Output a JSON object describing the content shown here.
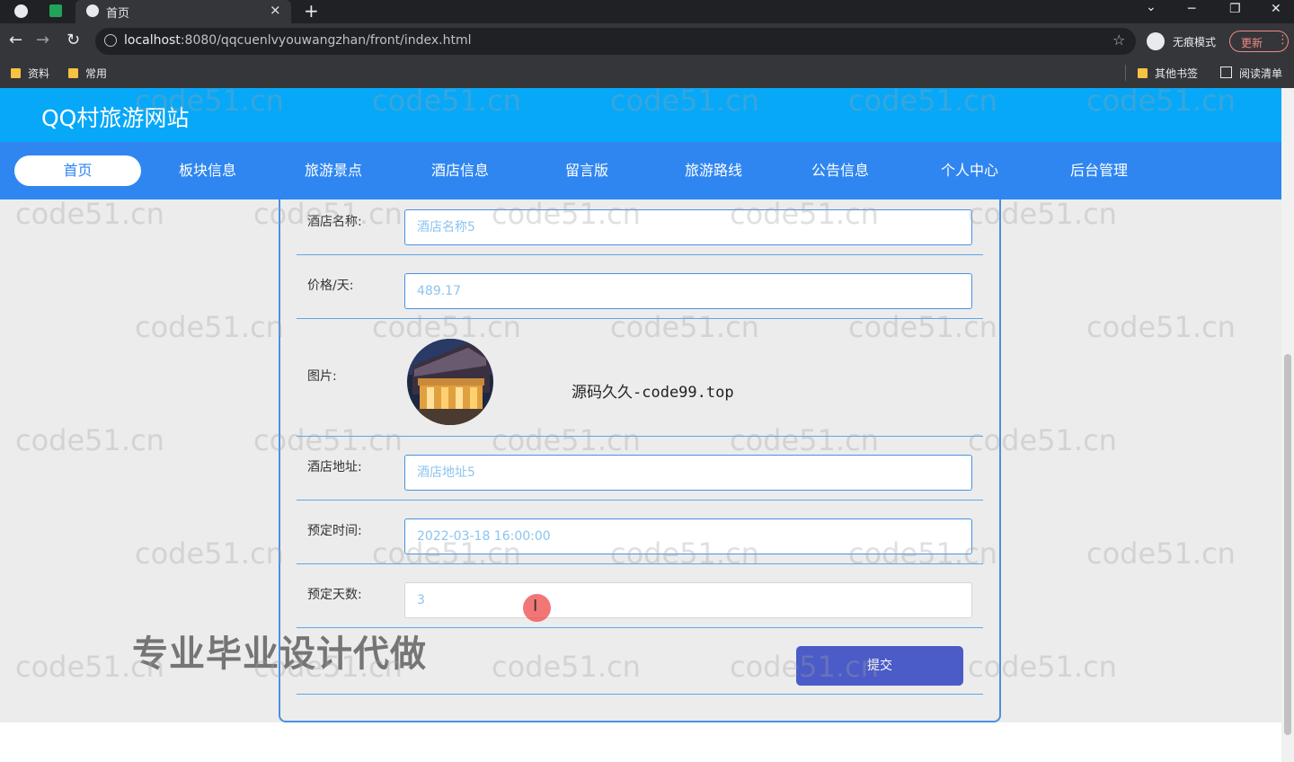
{
  "browser": {
    "tab_title": "首页",
    "tab_close": "×",
    "new_tab": "+",
    "url_host": "localhost",
    "url_rest": ":8080/qqcuenlvyouwangzhan/front/index.html",
    "incognito_label": "无痕模式",
    "update_label": "更新",
    "menu_glyph": "⋮",
    "back_glyph": "←",
    "forward_glyph": "→",
    "reload_glyph": "↻",
    "star_glyph": "☆",
    "min_glyph": "─",
    "max_glyph": "❐",
    "close_glyph": "✕",
    "tablist_glyph": "⌄",
    "bookmarks": [
      "资料",
      "常用"
    ],
    "other_bookmarks": "其他书签",
    "reading_list": "阅读清单"
  },
  "site": {
    "title": "QQ村旅游网站",
    "nav": [
      "首页",
      "板块信息",
      "旅游景点",
      "酒店信息",
      "留言版",
      "旅游路线",
      "公告信息",
      "个人中心",
      "后台管理"
    ]
  },
  "form": {
    "hotel_name_label": "酒店名称:",
    "hotel_name_value": "酒店名称5",
    "price_label": "价格/天:",
    "price_value": "489.17",
    "image_label": "图片:",
    "address_label": "酒店地址:",
    "address_value": "酒店地址5",
    "booking_time_label": "预定时间:",
    "booking_time_value": "2022-03-18 16:00:00",
    "days_label": "预定天数:",
    "days_value": "3",
    "submit_label": "提交"
  },
  "overlay": {
    "source_text": "源码久久-code99.top",
    "promo_text": "专业毕业设计代做",
    "watermark": "code51.cn"
  },
  "colors": {
    "header_bg": "#07a8f8",
    "nav_bg": "#2f86f0",
    "submit_bg": "#4b5bc7",
    "field_border": "#4a90e2"
  }
}
